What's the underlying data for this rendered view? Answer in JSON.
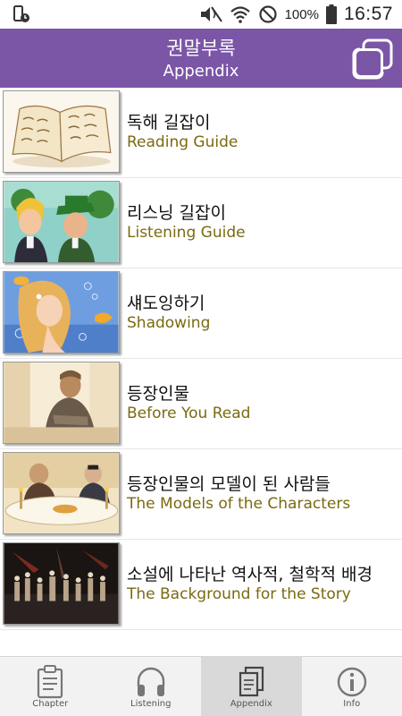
{
  "status_bar": {
    "battery_pct": "100%",
    "time": "16:57"
  },
  "header": {
    "title_ko": "권말부록",
    "title_en": "Appendix"
  },
  "items": [
    {
      "ko": "독해 길잡이",
      "en": "Reading Guide",
      "thumb": "open-book-illustration"
    },
    {
      "ko": "리스닝 길잡이",
      "en": "Listening Guide",
      "thumb": "two-characters-illustration"
    },
    {
      "ko": "섀도잉하기",
      "en": "Shadowing",
      "thumb": "mermaid-illustration"
    },
    {
      "ko": "등장인물",
      "en": "Before You Read",
      "thumb": "seated-man-illustration"
    },
    {
      "ko": "등장인물의 모델이 된 사람들",
      "en": "The Models of the Characters",
      "thumb": "dinner-table-illustration"
    },
    {
      "ko": "소설에 나타난 역사적, 철학적 배경",
      "en": "The Background for the Story",
      "thumb": "stage-crowd-photo"
    }
  ],
  "nav": [
    {
      "label": "Chapter",
      "icon": "clipboard-icon",
      "active": false
    },
    {
      "label": "Listening",
      "icon": "headphones-icon",
      "active": false
    },
    {
      "label": "Appendix",
      "icon": "pages-icon",
      "active": true
    },
    {
      "label": "Info",
      "icon": "info-icon",
      "active": false
    }
  ],
  "colors": {
    "header_bg": "#7b55a6",
    "english_label": "#7a6a10",
    "active_tab_bg": "#d9d9d9"
  }
}
